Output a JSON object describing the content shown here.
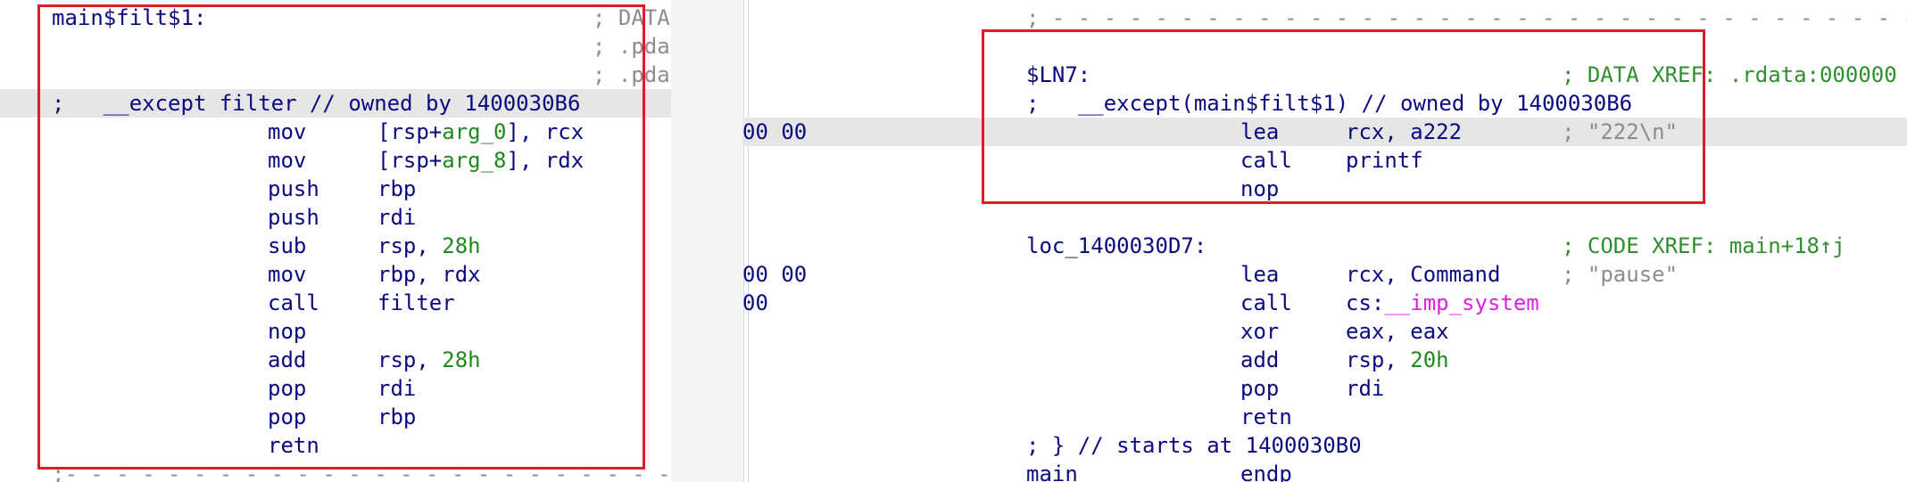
{
  "left": {
    "lines": [
      {
        "label": "main$filt$1:",
        "cmt": "; DATA"
      },
      {
        "cmt": "; .pdat"
      },
      {
        "cmt": "; .pdat"
      },
      {
        "cmt_full": ";   __except filter // owned by 1400030B6"
      },
      {
        "mn": "mov",
        "op_a": "[rsp+",
        "op_b": "arg_0",
        "op_c": "], rcx"
      },
      {
        "mn": "mov",
        "op_a": "[rsp+",
        "op_b": "arg_8",
        "op_c": "], rdx"
      },
      {
        "mn": "push",
        "op": "rbp"
      },
      {
        "mn": "push",
        "op": "rdi"
      },
      {
        "mn": "sub",
        "op": "rsp, ",
        "num": "28h"
      },
      {
        "mn": "mov",
        "op": "rbp, rdx"
      },
      {
        "mn": "call",
        "op": "filter"
      },
      {
        "mn": "nop"
      },
      {
        "mn": "add",
        "op": "rsp, ",
        "num": "28h"
      },
      {
        "mn": "pop",
        "op": "rdi"
      },
      {
        "mn": "pop",
        "op": "rbp"
      },
      {
        "mn": "retn"
      }
    ],
    "dashes_bottom": ";- - - - - - - - - - - - - - - - - - - - - - - - - - - -"
  },
  "right": {
    "dashes_top": "; - - - - - - - - - - - - - - - - - - - - - - - - - - - - - - - - - - - - - - - - - - - - - - -",
    "ln7_label": "$LN7:",
    "ln7_xref": "; DATA XREF: .rdata:000000",
    "except_cmt": ";   __except(main$filt$1) // owned by 1400030B6",
    "lea1": {
      "bytes": "00 00",
      "mn": "lea",
      "op": "rcx, a222",
      "cmt": "; \"222\\n\""
    },
    "call1": {
      "mn": "call",
      "op": "printf"
    },
    "nop1": {
      "mn": "nop"
    },
    "loc_label": "loc_1400030D7:",
    "loc_xref": "; CODE XREF: main+18↑j",
    "lea2": {
      "bytes": "00 00",
      "mn": "lea",
      "op": "rcx, Command",
      "cmt": "; \"pause\""
    },
    "call2": {
      "bytes": "00",
      "mn": "call",
      "op_a": "cs:",
      "op_b": "__imp_system"
    },
    "xor": {
      "mn": "xor",
      "op": "eax, eax"
    },
    "add": {
      "mn": "add",
      "op": "rsp, ",
      "num": "20h"
    },
    "pop": {
      "mn": "pop",
      "op": "rdi"
    },
    "retn": {
      "mn": "retn"
    },
    "starts_at": "; } // starts at 1400030B0",
    "endp_label": "main",
    "endp_mn": "endp"
  }
}
